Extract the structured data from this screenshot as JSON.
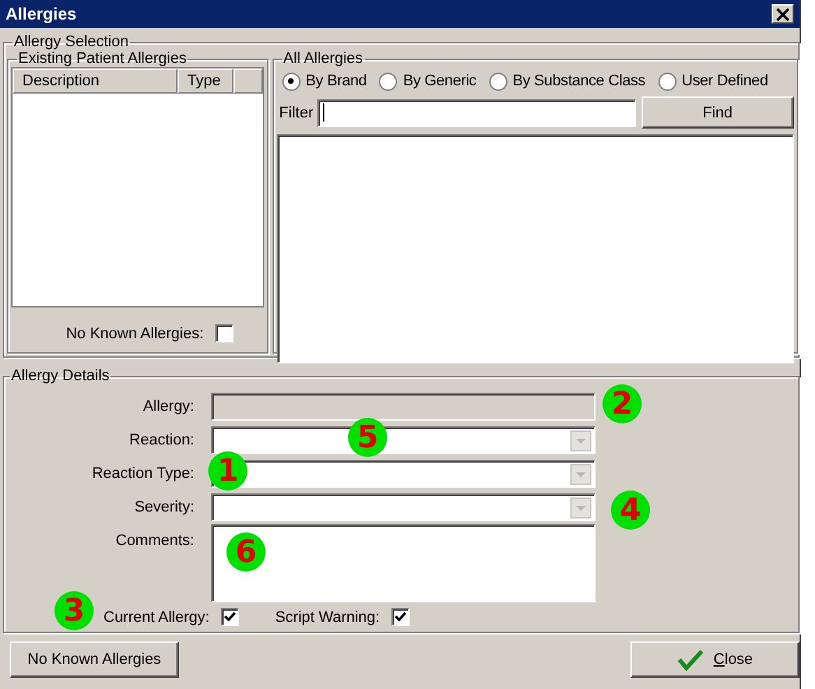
{
  "window": {
    "title": "Allergies"
  },
  "allergy_selection": {
    "title": "Allergy Selection",
    "existing": {
      "title": "Existing Patient Allergies",
      "columns": [
        "Description",
        "Type"
      ],
      "no_known": {
        "label": "No Known Allergies:",
        "checked": false
      }
    },
    "all_allergies": {
      "title": "All Allergies",
      "options": [
        {
          "label": "By Brand",
          "selected": true
        },
        {
          "label": "By Generic",
          "selected": false
        },
        {
          "label": "By Substance Class",
          "selected": false
        },
        {
          "label": "User Defined",
          "selected": false
        }
      ],
      "filter": {
        "label": "Filter"
      },
      "find_button": "Find"
    }
  },
  "details": {
    "title": "Allergy Details",
    "fields": [
      {
        "label": "Allergy:",
        "kind": "text",
        "disabled": true,
        "marker": "2"
      },
      {
        "label": "Reaction:",
        "kind": "dropdown",
        "disabled": false,
        "marker": "5"
      },
      {
        "label": "Reaction Type:",
        "kind": "dropdown",
        "disabled": false,
        "marker": "1"
      },
      {
        "label": "Severity:",
        "kind": "dropdown",
        "disabled": false,
        "marker": "4"
      },
      {
        "label": "Comments:",
        "kind": "memo",
        "disabled": false,
        "marker": "6"
      }
    ],
    "checks": [
      {
        "label": "Current Allergy:",
        "checked": true,
        "marker": "3"
      },
      {
        "label": "Script Warning:",
        "checked": true
      }
    ]
  },
  "buttons": {
    "no_known": "No Known Allergies",
    "close": "Close"
  }
}
